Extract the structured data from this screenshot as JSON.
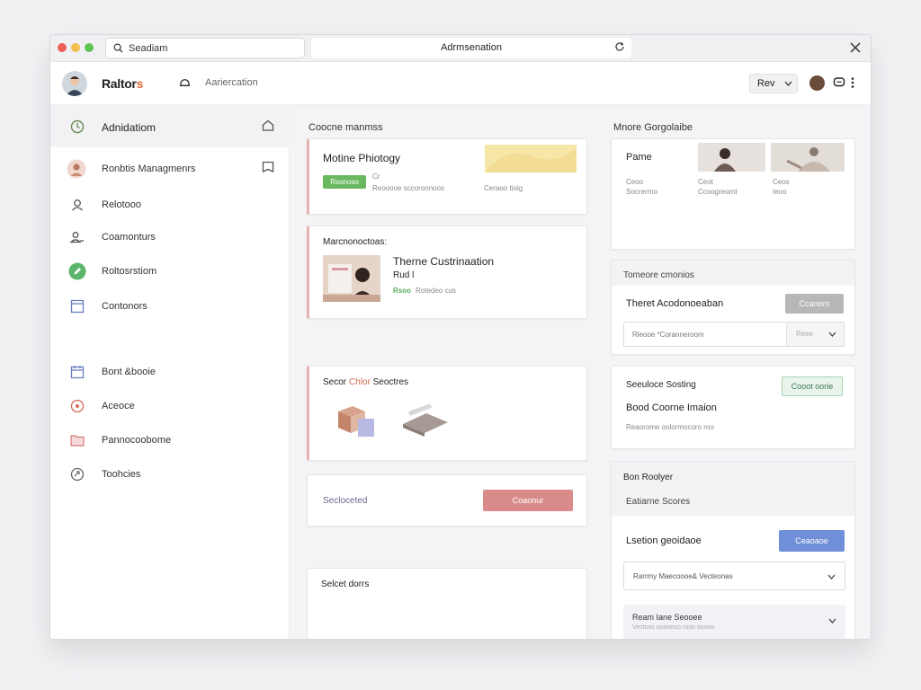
{
  "window": {
    "search_text": "Seadiam",
    "title": "Adrmsenation"
  },
  "appbar": {
    "brand_main": "Raltor",
    "brand_accent": "s",
    "subtitle": "Aariercation",
    "select_value": "Rev"
  },
  "sidebar": {
    "items": [
      {
        "label": "Adnidatiom",
        "icon": "clock-icon"
      },
      {
        "label": "Ronbtis Managmenrs",
        "icon": "user-avatar-icon"
      },
      {
        "label": "Relotooo",
        "icon": "person-icon"
      },
      {
        "label": "Coamonturs",
        "icon": "people-icon"
      },
      {
        "label": "Roltosrstiom",
        "icon": "edit-icon"
      },
      {
        "label": "Contonors",
        "icon": "document-icon"
      },
      {
        "label": "Bont &booie",
        "icon": "calendar-icon"
      },
      {
        "label": "Aceoce",
        "icon": "target-icon"
      },
      {
        "label": "Pannocoobome",
        "icon": "folder-icon"
      },
      {
        "label": "Toohcies",
        "icon": "tag-icon"
      }
    ]
  },
  "main": {
    "left_heading": "Coocne manmss",
    "right_heading": "Mnore Gorgolaibe",
    "card1": {
      "title": "Motine Phiotogy",
      "badge": "Rsonoso",
      "meta1": "Cr",
      "meta2": "Reooooe sccoronnoos",
      "meta3": "Ceraoo tioig"
    },
    "card2": {
      "label": "Marcnonoctoas:",
      "title": "Therne Custrinaation",
      "sub": "Rud l",
      "badge": "Rsoo",
      "meta": "Rotedeo cus"
    },
    "card3": {
      "label": "Secor",
      "label_accent": "Chlor",
      "label_rest": "Seoctres"
    },
    "card4": {
      "label": "Secloceted",
      "button": "Coaonur"
    },
    "card5": {
      "label": "Selcet dorrs"
    },
    "gallery": {
      "title": "Pame",
      "cols": [
        {
          "a": "Ceoo",
          "b": "Socrerrno"
        },
        {
          "a": "Ceot",
          "b": "Ccoogreomt"
        },
        {
          "a": "Ceos",
          "b": "Ieoo"
        }
      ]
    },
    "rcard2": {
      "heading": "Tomeore cmonios",
      "title": "Theret Acodonoeaban",
      "button": "Ccanorn",
      "input": "Rleooe *Coranneroom",
      "select": "Reee"
    },
    "rcard3": {
      "heading": "Seeuloce Sosting",
      "title": "Bood Coorne Imaion",
      "sub": "Reaorome oolormocoro roo",
      "button": "Cooot oorie"
    },
    "rcard4": {
      "heading": "Bon Roolyer",
      "sub": "Eatiarne Scores",
      "title": "Lsetion geoidaoe",
      "button": "Ceaoaoe",
      "select1": "Rarrmy Maecoooe& Vecteonas",
      "select2_title": "Ream Iane Seooee",
      "select2_sub": "Vectoos ooooeoo rooo ooooo"
    }
  },
  "colors": {
    "green_badge": "#69b85f",
    "red_button": "#d98b8b",
    "blue_button": "#6f8fd9",
    "grey_button": "#b7b7ba",
    "mint_button": "#e8f4ec",
    "accent_orange": "#e2683d"
  }
}
